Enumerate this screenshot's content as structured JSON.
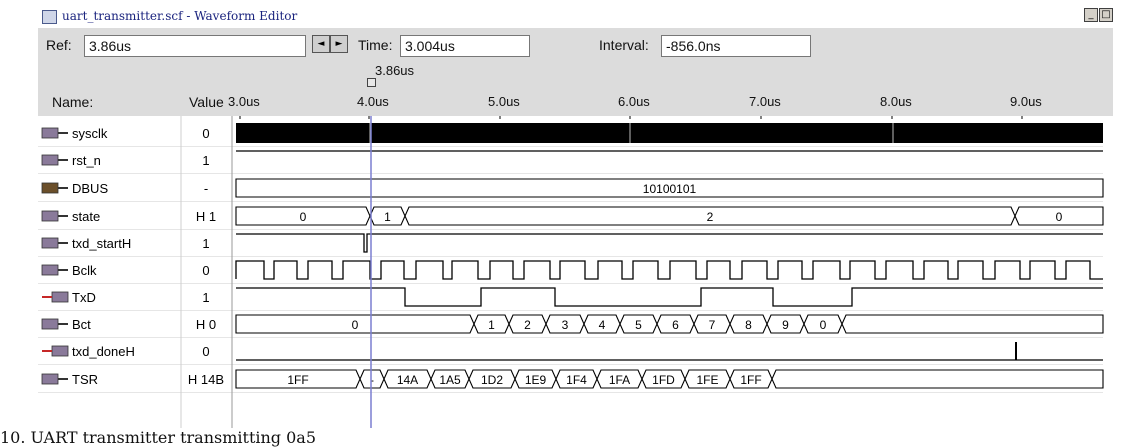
{
  "window": {
    "title": "uart_transmitter.scf - Waveform Editor",
    "minimize_label": "_",
    "maximize_label": "□"
  },
  "toolbar": {
    "ref_label": "Ref:",
    "ref_value": "3.86us",
    "time_label": "Time:",
    "time_value": "3.004us",
    "interval_label": "Interval:",
    "interval_value": "-856.0ns",
    "prev_label": "◄",
    "next_label": "►",
    "cursor_label": "3.86us"
  },
  "columns": {
    "name_header": "Name:",
    "value_header": "Value"
  },
  "time_axis": {
    "ticks": [
      "3.0us",
      "4.0us",
      "5.0us",
      "6.0us",
      "7.0us",
      "8.0us",
      "9.0us"
    ]
  },
  "signals": [
    {
      "name": "sysclk",
      "value": "0",
      "icon": "input-pin-icon"
    },
    {
      "name": "rst_n",
      "value": "1",
      "icon": "input-pin-icon"
    },
    {
      "name": "DBUS",
      "value": "-",
      "icon": "input-bus-icon"
    },
    {
      "name": "state",
      "value": "H 1",
      "icon": "buried-node-icon"
    },
    {
      "name": "txd_startH",
      "value": "1",
      "icon": "input-pin-icon"
    },
    {
      "name": "Bclk",
      "value": "0",
      "icon": "input-pin-icon"
    },
    {
      "name": "TxD",
      "value": "1",
      "icon": "output-pin-icon"
    },
    {
      "name": "Bct",
      "value": "H 0",
      "icon": "buried-node-icon"
    },
    {
      "name": "txd_doneH",
      "value": "0",
      "icon": "output-pin-icon"
    },
    {
      "name": "TSR",
      "value": "H 14B",
      "icon": "buried-node-icon"
    }
  ],
  "bus_labels": {
    "DBUS": [
      "10100101"
    ],
    "state": [
      "0",
      "1",
      "2",
      "0"
    ],
    "Bct": [
      "0",
      "1",
      "2",
      "3",
      "4",
      "5",
      "6",
      "7",
      "8",
      "9",
      "0"
    ],
    "TSR": [
      "1FF",
      "-",
      "14A",
      "1A5",
      "1D2",
      "1E9",
      "1F4",
      "1FA",
      "1FD",
      "1FE",
      "1FF"
    ]
  },
  "caption": "10. UART transmitter transmitting 0a5",
  "colors": {
    "waveform": "#000000",
    "cursor": "#7b7fd0",
    "header_bg": "#dcdcdc",
    "title_text": "#1a237e"
  }
}
